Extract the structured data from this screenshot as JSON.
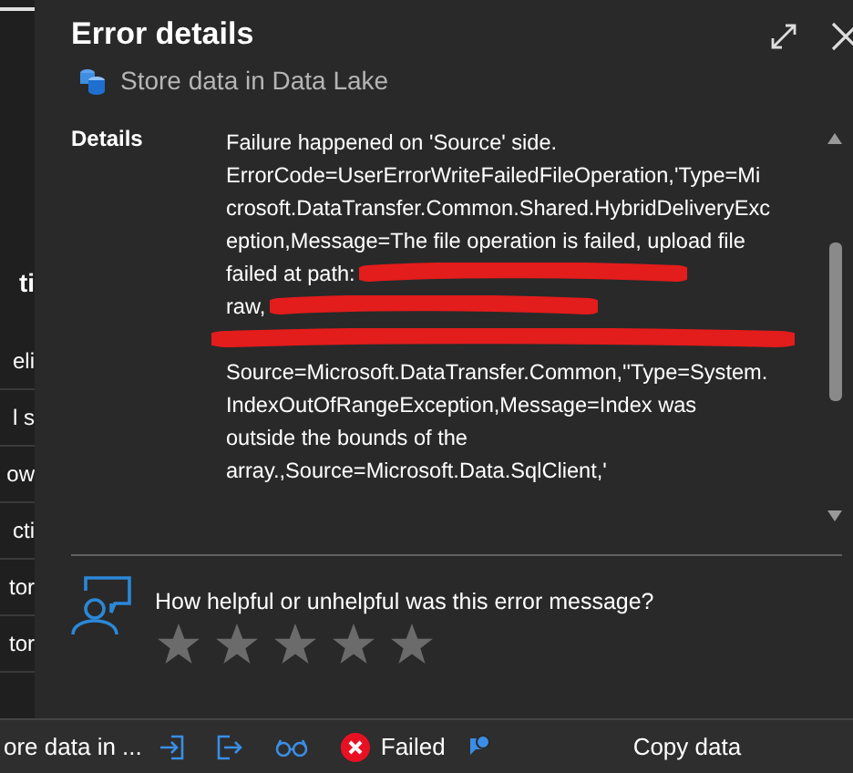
{
  "background_list": {
    "items": [
      {
        "text": "ti",
        "kind": "heading"
      },
      {
        "text": "eli",
        "kind": "row"
      },
      {
        "text": "l s",
        "kind": "row"
      },
      {
        "text": "ow",
        "kind": "row"
      },
      {
        "text": "cti",
        "kind": "row"
      },
      {
        "text": "tor",
        "kind": "row"
      },
      {
        "text": "tor",
        "kind": "row"
      }
    ]
  },
  "dialog": {
    "title": "Error details",
    "subtitle": "Store data in Data Lake",
    "details_label": "Details",
    "details_lines": [
      {
        "text": "Failure happened on 'Source' side.",
        "redacted": false
      },
      {
        "text": "ErrorCode=UserErrorWriteFailedFileOperation,'Type=Mi",
        "redacted": false
      },
      {
        "text": "crosoft.DataTransfer.Common.Shared.HybridDeliveryExc",
        "redacted": false
      },
      {
        "text": "eption,Message=The file operation is failed, upload file",
        "redacted": false
      },
      {
        "text": "failed at path:",
        "redacted": true
      },
      {
        "text": "raw,",
        "redacted": true
      },
      {
        "redacted": true
      },
      {
        "text": "Source=Microsoft.DataTransfer.Common,''Type=System.",
        "redacted": false
      },
      {
        "text": "IndexOutOfRangeException,Message=Index was",
        "redacted": false
      },
      {
        "text": "outside the bounds of the",
        "redacted": false
      },
      {
        "text": "array.,Source=Microsoft.Data.SqlClient,'",
        "redacted": false
      }
    ],
    "feedback": {
      "question": "How helpful or unhelpful was this error message?",
      "stars": 0
    }
  },
  "status_row": {
    "name": "ore data in ...",
    "status": "Failed",
    "type": "Copy data"
  }
}
